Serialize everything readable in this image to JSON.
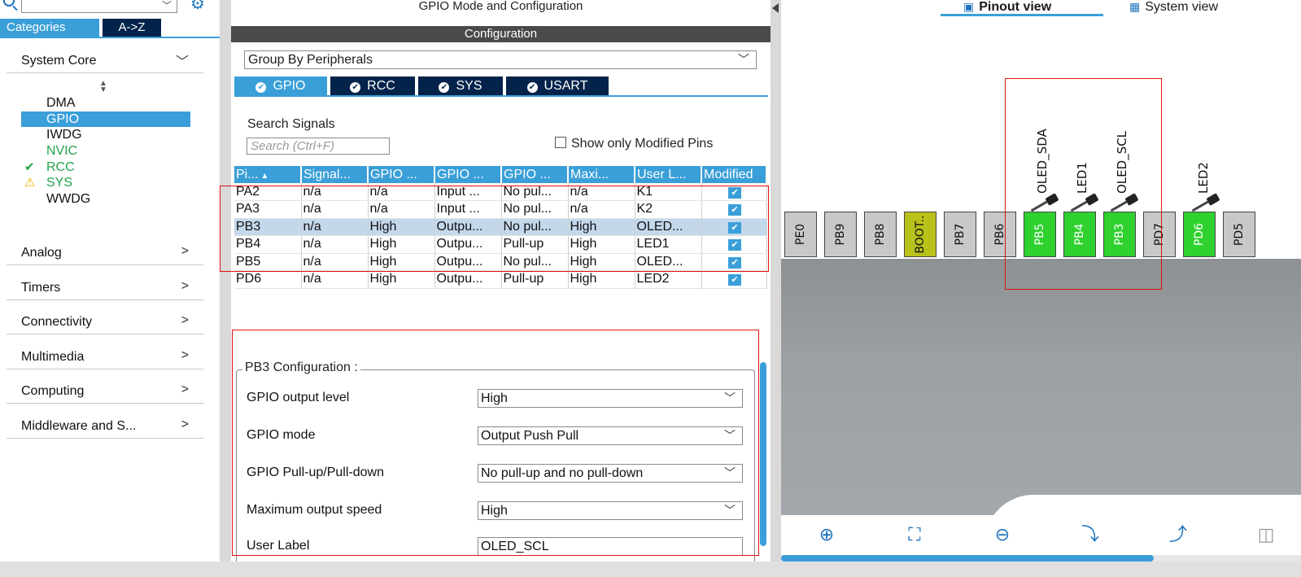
{
  "left_panel": {
    "categories_tab": "Categories",
    "az_tab": "A->Z",
    "groups": {
      "system_core": "System Core",
      "analog": "Analog",
      "timers": "Timers",
      "connectivity": "Connectivity",
      "multimedia": "Multimedia",
      "computing": "Computing",
      "middleware": "Middleware and S..."
    },
    "system_core_items": [
      {
        "label": "DMA",
        "state": "normal"
      },
      {
        "label": "GPIO",
        "state": "selected"
      },
      {
        "label": "IWDG",
        "state": "normal"
      },
      {
        "label": "NVIC",
        "state": "green"
      },
      {
        "label": "RCC",
        "state": "ok"
      },
      {
        "label": "SYS",
        "state": "warning"
      },
      {
        "label": "WWDG",
        "state": "normal"
      }
    ],
    "expanded_arrow": "﹀",
    "collapsed_arrow": ">"
  },
  "center_panel": {
    "title": "GPIO Mode and Configuration",
    "config_bar": "Configuration",
    "group_select": "Group By Peripherals",
    "tabs": [
      "GPIO",
      "RCC",
      "SYS",
      "USART"
    ],
    "search_signals_label": "Search Signals",
    "search_placeholder": "Search (Ctrl+F)",
    "show_modified_label": "Show only Modified Pins",
    "table_headers": [
      "Pi...",
      "Signal...",
      "GPIO ...",
      "GPIO ...",
      "GPIO ...",
      "Maxi...",
      "User L...",
      "Modified"
    ],
    "rows": [
      [
        "PA2",
        "n/a",
        "n/a",
        "Input ...",
        "No pul...",
        "n/a",
        "K1"
      ],
      [
        "PA3",
        "n/a",
        "n/a",
        "Input ...",
        "No pul...",
        "n/a",
        "K2"
      ],
      [
        "PB3",
        "n/a",
        "High",
        "Outpu...",
        "No pul...",
        "High",
        "OLED..."
      ],
      [
        "PB4",
        "n/a",
        "High",
        "Outpu...",
        "Pull-up",
        "High",
        "LED1"
      ],
      [
        "PB5",
        "n/a",
        "High",
        "Outpu...",
        "No pul...",
        "High",
        "OLED..."
      ],
      [
        "PD6",
        "n/a",
        "High",
        "Outpu...",
        "Pull-up",
        "High",
        "LED2"
      ]
    ],
    "selected_row": 2,
    "pb3_config": {
      "title": "PB3 Configuration :",
      "fields": [
        {
          "label": "GPIO output level",
          "value": "High"
        },
        {
          "label": "GPIO mode",
          "value": "Output Push Pull"
        },
        {
          "label": "GPIO Pull-up/Pull-down",
          "value": "No pull-up and no pull-down"
        },
        {
          "label": "Maximum output speed",
          "value": "High"
        },
        {
          "label": "User Label",
          "value": "OLED_SCL"
        }
      ]
    }
  },
  "right_panel": {
    "pinout_view": "Pinout view",
    "system_view": "System view",
    "pins": [
      {
        "label": "PE0",
        "color": "gray"
      },
      {
        "label": "PB9",
        "color": "gray"
      },
      {
        "label": "PB8",
        "color": "gray"
      },
      {
        "label": "BOOT..",
        "color": "yellow"
      },
      {
        "label": "PB7",
        "color": "gray"
      },
      {
        "label": "PB6",
        "color": "gray"
      },
      {
        "label": "PB5",
        "color": "green"
      },
      {
        "label": "PB4",
        "color": "green"
      },
      {
        "label": "PB3",
        "color": "green"
      },
      {
        "label": "PD7",
        "color": "gray"
      },
      {
        "label": "PD6",
        "color": "green"
      },
      {
        "label": "PD5",
        "color": "gray"
      }
    ],
    "signal_labels": [
      "OLED_SDA",
      "LED1",
      "OLED_SCL",
      "LED2"
    ],
    "toolbar_icons": [
      "zoom-in-icon",
      "fit-screen-icon",
      "zoom-out-icon",
      "rotate-right-icon",
      "rotate-left-icon",
      "split-view-icon"
    ]
  },
  "colors": {
    "accent": "#3a9fd8",
    "dark_navy": "#03234b",
    "pin_green": "#2ed12e",
    "pin_yellow": "#b9c21b",
    "highlight_red": "#e01010"
  }
}
